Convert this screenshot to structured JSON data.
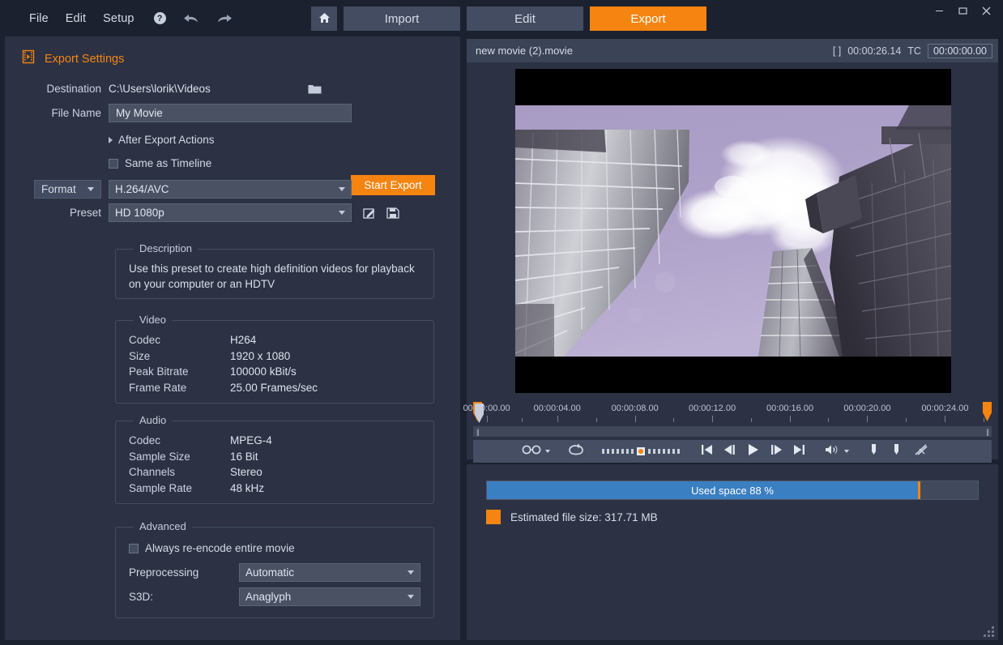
{
  "window": {
    "minimize": "−",
    "maximize": "▢",
    "close": "✕"
  },
  "menu": {
    "items": [
      {
        "label": "File",
        "name": "menu-file"
      },
      {
        "label": "Edit",
        "name": "menu-edit"
      },
      {
        "label": "Setup",
        "name": "menu-setup"
      }
    ],
    "help_label": "?",
    "undo_icon": "undo-arrow-icon",
    "redo_icon": "redo-arrow-icon"
  },
  "toolbar": {
    "home_icon": "home-icon",
    "import_label": "Import",
    "edit_label": "Edit",
    "export_label": "Export",
    "active_tab": "Export",
    "accent_color": "#f58410",
    "button_color": "#434c60"
  },
  "export_settings": {
    "panel_icon": "film-export-icon",
    "panel_title": "Export Settings",
    "destination_label": "Destination",
    "destination_value": "C:\\Users\\lorik\\Videos",
    "browse_icon": "folder-icon",
    "file_name_label": "File Name",
    "file_name_value": "My Movie",
    "file_name_placeholder": "My Movie",
    "after_export_label": "After Export Actions",
    "after_export_expanded": false,
    "start_export_label": "Start Export",
    "same_as_timeline_label": "Same as Timeline",
    "same_as_timeline_checked": false,
    "format_label": "Format",
    "format_value": "H.264/AVC",
    "preset_label": "Preset",
    "preset_value": "HD 1080p",
    "edit_preset_icon": "pencil-edit-icon",
    "save_preset_icon": "floppy-save-icon"
  },
  "description": {
    "title": "Description",
    "text": "Use this preset to create high definition videos for playback on your computer or an HDTV"
  },
  "video_group": {
    "title": "Video",
    "rows": [
      {
        "key": "Codec",
        "value": "H264"
      },
      {
        "key": "Size",
        "value": "1920 x 1080"
      },
      {
        "key": "Peak Bitrate",
        "value": "100000 kBit/s"
      },
      {
        "key": "Frame Rate",
        "value": "25.00 Frames/sec"
      }
    ]
  },
  "audio_group": {
    "title": "Audio",
    "rows": [
      {
        "key": "Codec",
        "value": "MPEG-4"
      },
      {
        "key": "Sample Size",
        "value": "16 Bit"
      },
      {
        "key": "Channels",
        "value": "Stereo"
      },
      {
        "key": "Sample Rate",
        "value": "48 kHz"
      }
    ]
  },
  "advanced_group": {
    "title": "Advanced",
    "reencode_label": "Always re-encode entire movie",
    "reencode_checked": false,
    "preprocessing_label": "Preprocessing",
    "preprocessing_value": "Automatic",
    "s3d_label": "S3D:",
    "s3d_value": "Anaglyph"
  },
  "preview": {
    "file_name": "new movie (2).movie",
    "duration_prefix": "[ ]",
    "duration": "00:00:26.14",
    "tc_label": "TC",
    "tc_value": "00:00:00.00"
  },
  "timeline": {
    "ticks": [
      "00:00:00.00",
      "00:00:04.00",
      "00:00:08.00",
      "00:00:12.00",
      "00:00:16.00",
      "00:00:20.00",
      "00:00:24.00"
    ],
    "playhead_position_pct": 0,
    "in_marker_pct": 0,
    "out_marker_pct": 100
  },
  "transport": {
    "preview_quality_icon": "glasses-icon",
    "loop_icon": "loop-icon",
    "jog_shuttle_icon": "jog-shuttle-slider",
    "skip_start_icon": "skip-to-start-icon",
    "step_back_icon": "step-backward-icon",
    "play_icon": "play-icon",
    "step_forward_icon": "step-forward-icon",
    "skip_end_icon": "skip-to-end-icon",
    "volume_icon": "volume-icon",
    "mark_in_icon": "mark-in-icon",
    "mark_out_icon": "mark-out-icon",
    "cut_icon": "cut-scissors-icon"
  },
  "usage": {
    "bar_label": "Used space 88 %",
    "used_percent": 88,
    "marker_percent": 88,
    "bar_fill_color": "#3a7fc1",
    "marker_color": "#f58410",
    "estimated_size_label": "Estimated file size: 317.71 MB"
  }
}
